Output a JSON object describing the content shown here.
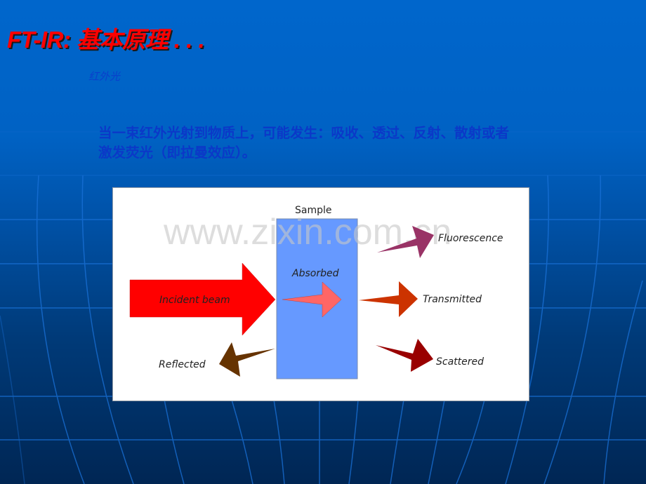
{
  "slide": {
    "title": "FT-IR: 基本原理 . . .",
    "subtitle": "红外光",
    "body_line1": "当一束红外光射到物质上，可能发生：吸收、透过、反射、散射或者",
    "body_line2": "激发荧光（即拉曼效应）。"
  },
  "diagram": {
    "watermark": "www.zixin.com.cn",
    "sample_label": "Sample",
    "incident_label": "Incident beam",
    "absorbed_label": "Absorbed",
    "fluorescence_label": "Fluorescence",
    "transmitted_label": "Transmitted",
    "reflected_label": "Reflected",
    "scattered_label": "Scattered",
    "colors": {
      "incident": "#ff0000",
      "incident_text": "#ffcc00",
      "sample": "#6699ff",
      "absorbed": "#ff6666",
      "fluorescence": "#993366",
      "transmitted": "#cc3300",
      "reflected": "#663300",
      "scattered": "#990000"
    }
  }
}
